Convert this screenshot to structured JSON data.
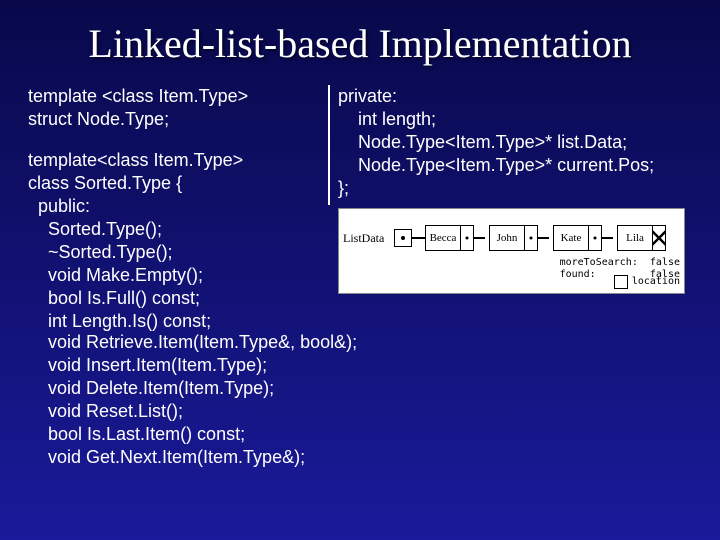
{
  "title": "Linked-list-based Implementation",
  "left": {
    "block1": "template <class Item.Type>\nstruct Node.Type;",
    "block2": "template<class Item.Type>\nclass Sorted.Type {\n  public:\n    Sorted.Type();\n    ~Sorted.Type();\n    void Make.Empty();\n    bool Is.Full() const;\n    int Length.Is() const;"
  },
  "right": {
    "block": "private:\n    int length;\n    Node.Type<Item.Type>* list.Data;\n    Node.Type<Item.Type>* current.Pos;\n};"
  },
  "fullwidth": "    void Retrieve.Item(Item.Type&, bool&);\n    void Insert.Item(Item.Type);\n    void Delete.Item(Item.Type);\n    void Reset.List();\n    bool Is.Last.Item() const;\n    void Get.Next.Item(Item.Type&);",
  "diagram": {
    "ptr_label": "ListData",
    "nodes": [
      "Becca",
      "John",
      "Kate",
      "Lila"
    ],
    "more_line": "moreToSearch:  false",
    "found_line": "found:         false",
    "location_label": "location"
  }
}
